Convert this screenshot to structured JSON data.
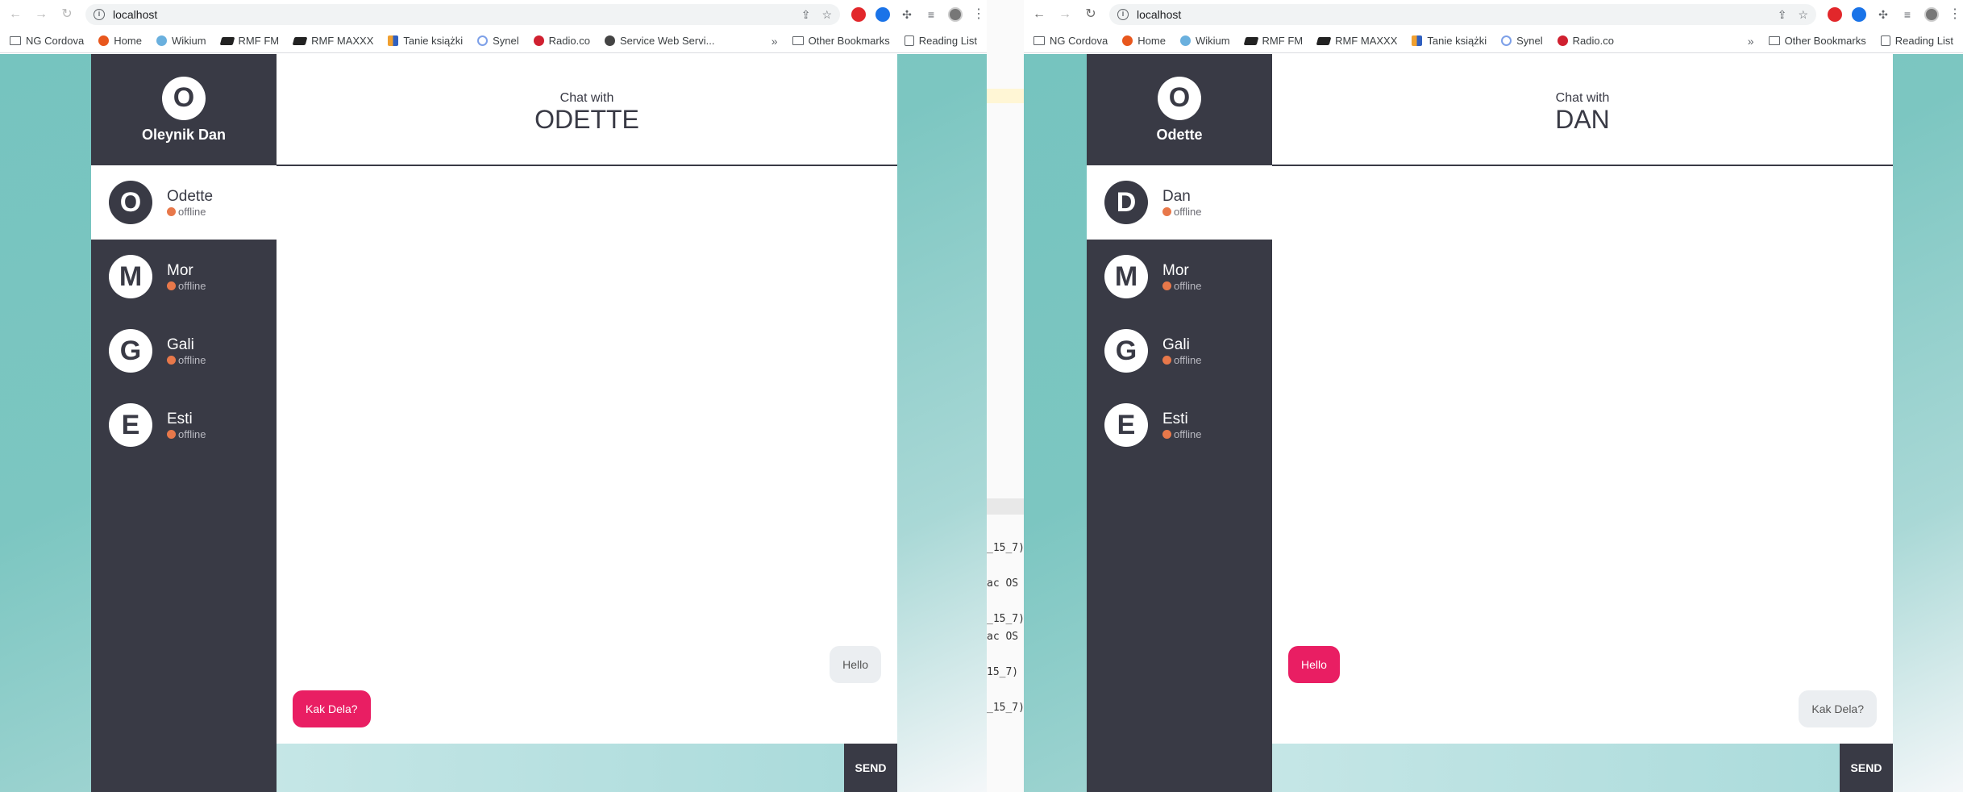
{
  "browser": {
    "url": "localhost",
    "bookmarks_left": [
      {
        "label": "NG Cordova",
        "icon": "folder-icon"
      },
      {
        "label": "Home",
        "icon": "home-favicon"
      },
      {
        "label": "Wikium",
        "icon": "wikium-favicon"
      },
      {
        "label": "RMF FM",
        "icon": "rmf-favicon"
      },
      {
        "label": "RMF MAXXX",
        "icon": "rmf-maxxx-favicon"
      },
      {
        "label": "Tanie książki",
        "icon": "tanie-favicon"
      },
      {
        "label": "Synel",
        "icon": "synel-favicon"
      },
      {
        "label": "Radio.co",
        "icon": "radio-favicon"
      },
      {
        "label": "Service Web Servi...",
        "icon": "service-favicon"
      }
    ],
    "bookmarks_right": [
      {
        "label": "NG Cordova"
      },
      {
        "label": "Home"
      },
      {
        "label": "Wikium"
      },
      {
        "label": "RMF FM"
      },
      {
        "label": "RMF MAXXX"
      },
      {
        "label": "Tanie książki"
      },
      {
        "label": "Synel"
      },
      {
        "label": "Radio.co"
      }
    ],
    "other_bookmarks": "Other Bookmarks",
    "reading_list": "Reading List",
    "overflow": "»"
  },
  "terminal_lines": [
    "_15_7)",
    "ac OS",
    "_15_7)",
    "ac OS",
    "15_7)",
    "_15_7)"
  ],
  "left_window": {
    "me": {
      "initial": "O",
      "name": "Oleynik Dan"
    },
    "chat_with_label": "Chat with",
    "peer": "ODETTE",
    "contacts": [
      {
        "initial": "O",
        "name": "Odette",
        "status": "offline",
        "active": true
      },
      {
        "initial": "M",
        "name": "Mor",
        "status": "offline"
      },
      {
        "initial": "G",
        "name": "Gali",
        "status": "offline"
      },
      {
        "initial": "E",
        "name": "Esti",
        "status": "offline"
      }
    ],
    "messages": [
      {
        "text": "Hello",
        "direction": "in"
      },
      {
        "text": "Kak Dela?",
        "direction": "out"
      }
    ],
    "send_label": "SEND"
  },
  "right_window": {
    "me": {
      "initial": "O",
      "name": "Odette"
    },
    "chat_with_label": "Chat with",
    "peer": "DAN",
    "contacts": [
      {
        "initial": "D",
        "name": "Dan",
        "status": "offline",
        "active": true
      },
      {
        "initial": "M",
        "name": "Mor",
        "status": "offline"
      },
      {
        "initial": "G",
        "name": "Gali",
        "status": "offline"
      },
      {
        "initial": "E",
        "name": "Esti",
        "status": "offline"
      }
    ],
    "messages": [
      {
        "text": "Hello",
        "direction": "out"
      },
      {
        "text": "Kak Dela?",
        "direction": "in"
      }
    ],
    "send_label": "SEND"
  },
  "colors": {
    "sidebar": "#393a45",
    "accent": "#e91e63",
    "status_offline": "#e8784a",
    "background_teal": "#7cc6c1"
  }
}
